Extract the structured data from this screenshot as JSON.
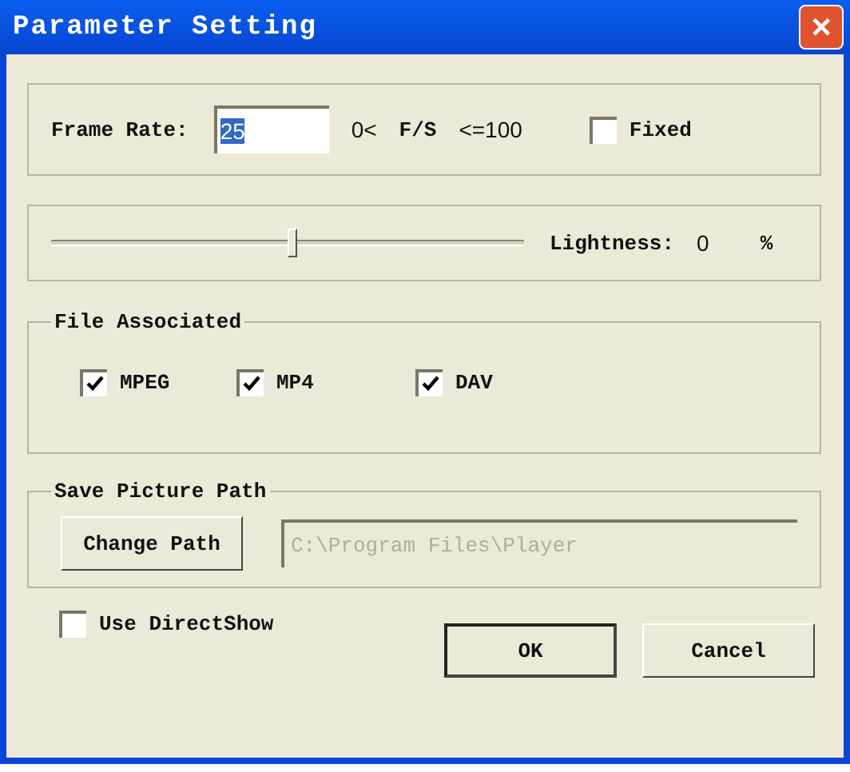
{
  "window": {
    "title": "Parameter Setting",
    "close": "✕"
  },
  "frame_rate": {
    "label": "Frame Rate:",
    "value": "25",
    "value_selected": true,
    "range_min": "0<",
    "unit": "F/S",
    "range_max": "<=100",
    "fixed": {
      "label": "Fixed",
      "checked": false
    }
  },
  "lightness": {
    "level": 0.51,
    "label": "Lightness:",
    "reading": "0",
    "unit": "%"
  },
  "file_associated": {
    "title": "File Associated",
    "items": [
      {
        "label": "MPEG",
        "checked": true
      },
      {
        "label": "MP4",
        "checked": true
      },
      {
        "label": "DAV",
        "checked": true
      }
    ]
  },
  "save_picture_path": {
    "title": "Save Picture Path",
    "button": "Change Path",
    "path": "C:\\Program Files\\Player",
    "path_disabled": true
  },
  "use_directshow": {
    "label": "Use DirectShow",
    "checked": false
  },
  "buttons": [
    {
      "label": "OK",
      "default": true
    },
    {
      "label": "Cancel",
      "default": false
    }
  ]
}
